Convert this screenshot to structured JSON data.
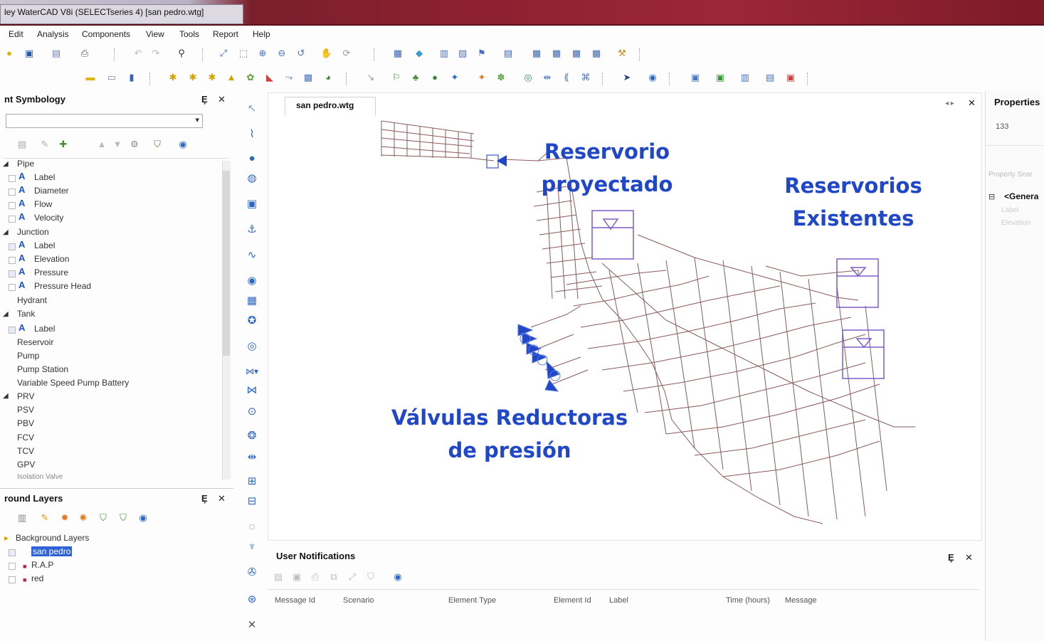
{
  "window": {
    "title": "ley WaterCAD V8i (SELECTseries 4) [san pedro.wtg]"
  },
  "menu": [
    "Edit",
    "Analysis",
    "Components",
    "View",
    "Tools",
    "Report",
    "Help"
  ],
  "symbology": {
    "title": "nt Symbology",
    "controls": {
      "pin": "Ȩ",
      "close": "✕"
    },
    "items": [
      "Pipe",
      "Label",
      "Diameter",
      "Flow",
      "Velocity",
      "Junction",
      "Label",
      "Elevation",
      "Pressure",
      "Pressure Head",
      "Hydrant",
      "Tank",
      "Label",
      "Reservoir",
      "Pump",
      "Pump Station",
      "Variable Speed Pump Battery",
      "PRV",
      "PSV",
      "PBV",
      "FCV",
      "TCV",
      "GPV",
      "Isolation Valve"
    ]
  },
  "background_layers": {
    "title": "round Layers",
    "items": [
      "Background Layers",
      "san pedro",
      "R.A.P",
      "red"
    ]
  },
  "document": {
    "tab_label": "san pedro.wtg"
  },
  "annotations": {
    "reservorio_proyectado": "Reservorio proyectado",
    "reservorios_existentes": "Reservorios Existentes",
    "valvulas": "Válvulas Reductoras de presión"
  },
  "properties": {
    "title": "Properties",
    "value": "133",
    "search_placeholder": "Property Sear",
    "group": "<Genera",
    "fields": [
      "Label",
      "Elevation"
    ]
  },
  "notifications": {
    "title": "User Notifications",
    "columns": [
      "Message Id",
      "Scenario",
      "Element Type",
      "Element Id",
      "Label",
      "Time (hours)",
      "Message"
    ]
  },
  "colors": {
    "accent_blue": "#1f47c8",
    "network": "#8a5a5a",
    "element_purple": "#7e5cc8",
    "titlebar": "#8c2030"
  }
}
